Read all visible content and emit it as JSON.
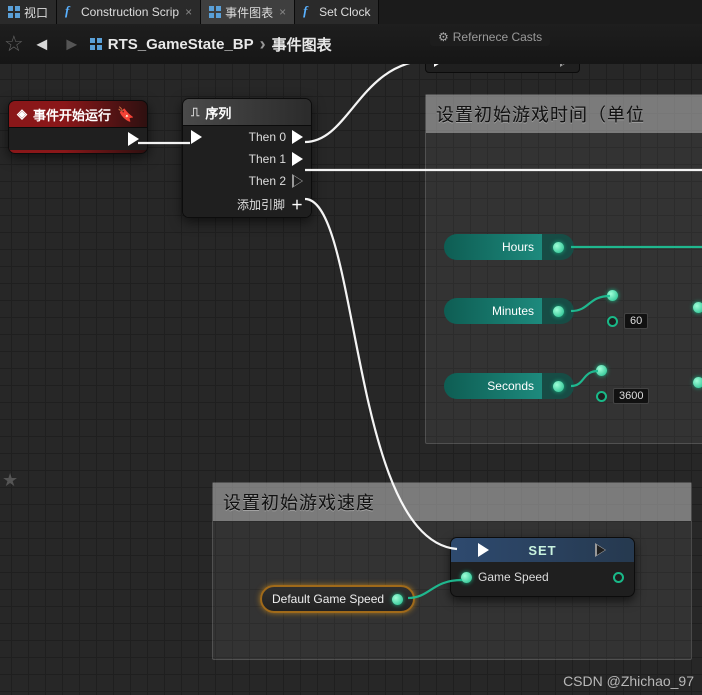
{
  "tabs": [
    {
      "label": "视口",
      "iconType": "grid"
    },
    {
      "label": "Construction Scrip",
      "iconType": "f"
    },
    {
      "label": "事件图表",
      "iconType": "grid",
      "active": true
    },
    {
      "label": "Set Clock",
      "iconType": "f"
    }
  ],
  "refCasts": {
    "label": "Refernece Casts"
  },
  "breadcrumb": {
    "root": "RTS_GameState_BP",
    "leaf": "事件图表"
  },
  "eventNode": {
    "title": "事件开始运行"
  },
  "sequenceNode": {
    "title": "序列",
    "pins": [
      "Then 0",
      "Then 1",
      "Then 2"
    ],
    "addPin": "添加引脚"
  },
  "commentTime": {
    "title": "设置初始游戏时间（单位"
  },
  "commentSpeed": {
    "title": "设置初始游戏速度"
  },
  "timePins": {
    "hours": "Hours",
    "minutes": "Minutes",
    "seconds": "Seconds",
    "minVal": "60",
    "secVal": "3600"
  },
  "varNode": {
    "label": "Default Game Speed"
  },
  "setNode": {
    "title": "SET",
    "var": "Game Speed"
  },
  "watermark": "CSDN @Zhichao_97"
}
